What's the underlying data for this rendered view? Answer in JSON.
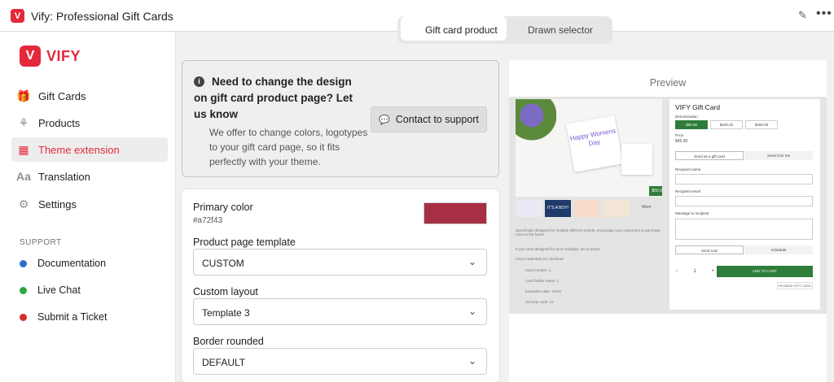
{
  "window": {
    "title": "Vify: Professional Gift Cards",
    "logo_letter": "V"
  },
  "brand": {
    "name": "VIFY",
    "accent": "#e4283b"
  },
  "sidebar": {
    "items": [
      {
        "label": "Gift Cards",
        "icon": "gift-icon"
      },
      {
        "label": "Products",
        "icon": "products-icon"
      },
      {
        "label": "Theme extension",
        "icon": "grid-icon",
        "active": true
      },
      {
        "label": "Translation",
        "icon": "translation-icon"
      },
      {
        "label": "Settings",
        "icon": "gear-icon"
      }
    ],
    "support_label": "SUPPORT",
    "support_items": [
      {
        "label": "Documentation",
        "color": "#2c6ecb"
      },
      {
        "label": "Live Chat",
        "color": "#29a846"
      },
      {
        "label": "Submit a Ticket",
        "color": "#d82c2c"
      }
    ]
  },
  "tabs": {
    "active": "Gift card product",
    "other": "Drawn selector"
  },
  "notice": {
    "title": "Need to change the design on gift card product page? Let us know",
    "body": "We offer to change colors, logotypes to your gift card page, so it fits perfectly with your theme.",
    "button": "Contact to support"
  },
  "form": {
    "primary_color_label": "Primary color",
    "primary_color_value": "#a72f43",
    "template_label": "Product page template",
    "template_value": "CUSTOM",
    "layout_label": "Custom layout",
    "layout_value": "Template 3",
    "border_label": "Border rounded",
    "border_value": "DEFAULT"
  },
  "preview": {
    "label": "Preview",
    "card_text": "Happy Womens Day",
    "price_badge": "$60.00",
    "more": "More",
    "thumb_2": "IT'S A BOY!",
    "desc_1": "Specifically designed for multiple different events, encourage your customers to purchase more in the future.",
    "desc_2": "If you need designed for more holidays, let us know!",
    "desc_3": "Card credentials for checkout:",
    "list": [
      "Card number: 1",
      "Card holder name: 1",
      "Expiration date: 12/29",
      "Security code: 11"
    ],
    "product_title": "VIFY Gift Card",
    "denomination_label": "Denomination",
    "denominations": [
      "$50.00",
      "$100.00",
      "$200.00"
    ],
    "price_label": "Price",
    "price": "$45.00",
    "send_gift": "Send as a gift card",
    "send_me": "Send it for me",
    "recipient_name": "Recipient name",
    "recipient_email": "Recipient email",
    "message": "Message to recipient",
    "send_now": "Send now",
    "schedule": "Schedule",
    "qty": "1",
    "add_to_cart": "ADD TO CART",
    "redeem": "REDEEM GIFT CARD",
    "green": "#2f7d3a"
  }
}
